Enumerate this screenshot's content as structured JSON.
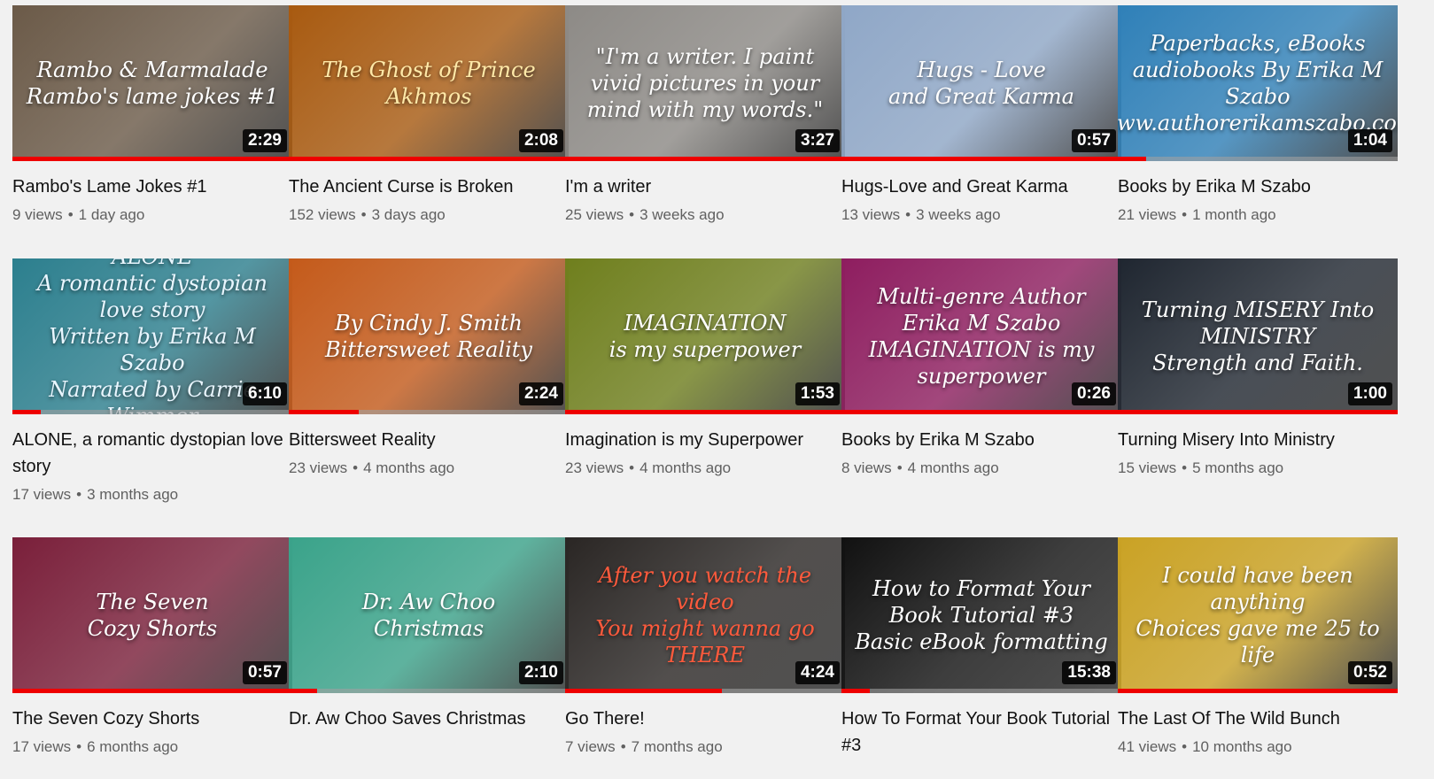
{
  "videos": [
    {
      "title": "Rambo's Lame Jokes #1",
      "views": "9 views",
      "age": "1 day ago",
      "duration": "2:29",
      "thumb_text": "Rambo & Marmalade\nRambo's lame jokes #1",
      "bg": "#6b5a48",
      "fg": "#ffffff",
      "watched": 1.0
    },
    {
      "title": "The Ancient Curse is Broken",
      "views": "152 views",
      "age": "3 days ago",
      "duration": "2:08",
      "thumb_text": "The Ghost of Prince Akhmos",
      "bg": "#a85a10",
      "fg": "#ffe9a8",
      "watched": 1.0
    },
    {
      "title": "I'm a writer",
      "views": "25 views",
      "age": "3 weeks ago",
      "duration": "3:27",
      "thumb_text": "\"I'm a writer. I paint vivid pictures in your mind with my words.\"",
      "bg": "#8d8a86",
      "fg": "#ffffff",
      "watched": 1.0
    },
    {
      "title": "Hugs-Love and Great Karma",
      "views": "13 views",
      "age": "3 weeks ago",
      "duration": "0:57",
      "thumb_text": "Hugs - Love\nand Great Karma",
      "bg": "#8fa7c7",
      "fg": "#ffffff",
      "watched": 1.0
    },
    {
      "title": "Books by Erika M Szabo",
      "views": "21 views",
      "age": "1 month ago",
      "duration": "1:04",
      "thumb_text": "Paperbacks, eBooks audiobooks By Erika M Szabo\nwww.authorerikamszabo.com",
      "bg": "#2f80b8",
      "fg": "#ffffff",
      "watched": 0.1
    },
    {
      "title": "ALONE, a romantic dystopian love story",
      "views": "17 views",
      "age": "3 months ago",
      "duration": "6:10",
      "thumb_text": "ALONE\nA romantic dystopian love story\nWritten by Erika M Szabo\nNarrated by Carrie Wimmer",
      "bg": "#2c7f8e",
      "fg": "#e9f6ff",
      "watched": 0.1
    },
    {
      "title": "Bittersweet Reality",
      "views": "23 views",
      "age": "4 months ago",
      "duration": "2:24",
      "thumb_text": "By Cindy J. Smith\nBittersweet Reality",
      "bg": "#c45a1a",
      "fg": "#ffffff",
      "watched": 0.25
    },
    {
      "title": "Imagination is my Superpower",
      "views": "23 views",
      "age": "4 months ago",
      "duration": "1:53",
      "thumb_text": "IMAGINATION\nis my superpower",
      "bg": "#6f7f1d",
      "fg": "#ffffff",
      "watched": 1.0
    },
    {
      "title": "Books by Erika M Szabo",
      "views": "8 views",
      "age": "4 months ago",
      "duration": "0:26",
      "thumb_text": "Multi-genre Author\nErika M Szabo\nIMAGINATION is my superpower",
      "bg": "#8e1d5f",
      "fg": "#ffffff",
      "watched": 1.0
    },
    {
      "title": "Turning Misery Into Ministry",
      "views": "15 views",
      "age": "5 months ago",
      "duration": "1:00",
      "thumb_text": "Turning MISERY Into MINISTRY\nStrength and Faith.",
      "bg": "#1f2630",
      "fg": "#ffffff",
      "watched": 1.0
    },
    {
      "title": "The Seven Cozy Shorts",
      "views": "17 views",
      "age": "6 months ago",
      "duration": "0:57",
      "thumb_text": "The Seven\nCozy Shorts",
      "bg": "#7a1f3a",
      "fg": "#ffffff",
      "watched": 1.0
    },
    {
      "title": "Dr. Aw Choo Saves Christmas",
      "views": "",
      "age": "",
      "duration": "2:10",
      "thumb_text": "Dr. Aw Choo\nChristmas",
      "bg": "#3aa38a",
      "fg": "#ffffff",
      "watched": 0.1
    },
    {
      "title": "Go There!",
      "views": "7 views",
      "age": "7 months ago",
      "duration": "4:24",
      "thumb_text": "After you watch the video\nYou might wanna go THERE",
      "bg": "#2a2624",
      "fg": "#ff5a3c",
      "watched": 0.56
    },
    {
      "title": "How To Format Your Book Tutorial #3",
      "views": "",
      "age": "",
      "duration": "15:38",
      "thumb_text": "How to Format Your Book Tutorial #3\nBasic eBook formatting",
      "bg": "#111111",
      "fg": "#ffffff",
      "watched": 0.1
    },
    {
      "title": "The Last Of The Wild Bunch",
      "views": "41 views",
      "age": "10 months ago",
      "duration": "0:52",
      "thumb_text": "I could have been anything\nChoices gave me 25 to life",
      "bg": "#caa224",
      "fg": "#ffffff",
      "watched": 1.0
    }
  ]
}
